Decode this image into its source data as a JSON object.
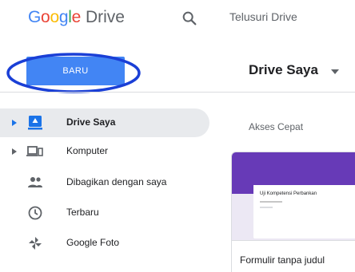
{
  "header": {
    "logo_letters": [
      {
        "char": "G",
        "color": "#4285f4"
      },
      {
        "char": "o",
        "color": "#ea4335"
      },
      {
        "char": "o",
        "color": "#fbbc05"
      },
      {
        "char": "g",
        "color": "#4285f4"
      },
      {
        "char": "l",
        "color": "#34a853"
      },
      {
        "char": "e",
        "color": "#ea4335"
      }
    ],
    "product_name": "Drive",
    "search_placeholder": "Telusuri Drive",
    "search_icon": "search-icon"
  },
  "new_button": {
    "label": "BARU",
    "color": "#4285f4",
    "annotation_color": "#1a3fd6"
  },
  "main": {
    "title": "Drive Saya",
    "section_label": "Akses Cepat",
    "quick_access": [
      {
        "title": "Formulir tanpa judul",
        "preview_heading": "Uji Kompetensi Perbankan",
        "accent_color": "#673ab7"
      }
    ]
  },
  "sidebar": {
    "items": [
      {
        "label": "Drive Saya",
        "icon": "drive-icon",
        "active": true,
        "expandable": true
      },
      {
        "label": "Komputer",
        "icon": "computer-icon",
        "active": false,
        "expandable": true
      },
      {
        "label": "Dibagikan dengan saya",
        "icon": "shared-people-icon",
        "active": false,
        "expandable": false
      },
      {
        "label": "Terbaru",
        "icon": "clock-icon",
        "active": false,
        "expandable": false
      },
      {
        "label": "Google Foto",
        "icon": "photos-pinwheel-icon",
        "active": false,
        "expandable": false
      }
    ]
  }
}
